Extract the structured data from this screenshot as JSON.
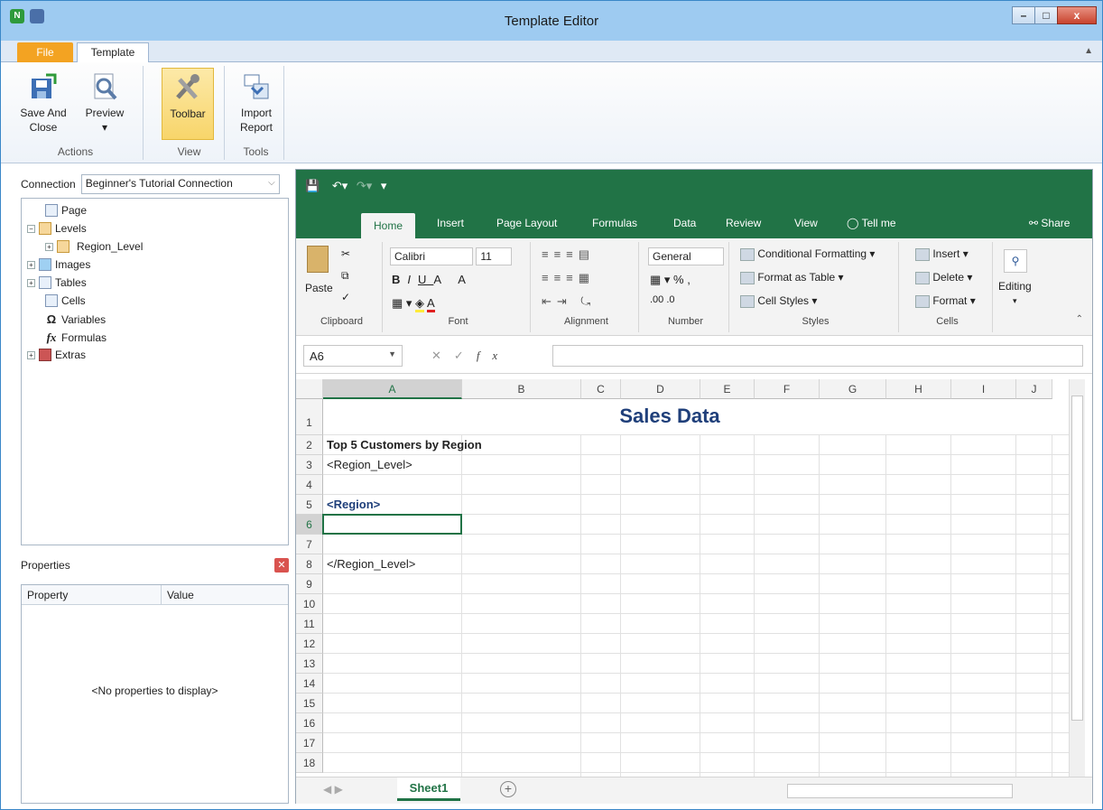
{
  "window": {
    "title": "Template Editor",
    "minimize": "–",
    "maximize": "□",
    "close": "x",
    "app_icon": "N"
  },
  "tabs": {
    "file": "File",
    "template": "Template",
    "collapse_icon": "chevron-up-icon"
  },
  "ribbon": {
    "groups": [
      {
        "label": "Actions",
        "buttons": [
          "Save And Close",
          "Preview"
        ]
      },
      {
        "label": "View",
        "buttons": [
          "Toolbar"
        ]
      },
      {
        "label": "Tools",
        "buttons": [
          "Import Report"
        ]
      }
    ],
    "save_line1": "Save And",
    "save_line2": "Close",
    "preview": "Preview",
    "preview_dd": "▾",
    "toolbar": "Toolbar",
    "import_line1": "Import",
    "import_line2": "Report",
    "actions_label": "Actions",
    "view_label": "View",
    "tools_label": "Tools"
  },
  "connection": {
    "label": "Connection",
    "value": "Beginner's Tutorial Connection"
  },
  "tree": {
    "page": "Page",
    "levels": "Levels",
    "region_level": "Region_Level",
    "images": "Images",
    "tables": "Tables",
    "cells": "Cells",
    "variables": "Variables",
    "formulas": "Formulas",
    "extras": "Extras"
  },
  "properties": {
    "title": "Properties",
    "col_property": "Property",
    "col_value": "Value",
    "empty": "<No properties to display>"
  },
  "excel": {
    "tabs": [
      "Home",
      "Insert",
      "Page Layout",
      "Formulas",
      "Data",
      "Review",
      "View",
      "Tell me"
    ],
    "share": "Share",
    "paste": "Paste",
    "clipboard": "Clipboard",
    "font_name": "Calibri",
    "font_size": "11",
    "font": "Font",
    "alignment": "Alignment",
    "number_format": "General",
    "number": "Number",
    "conditional_formatting": "Conditional Formatting",
    "format_as_table": "Format as Table",
    "cell_styles": "Cell Styles",
    "styles": "Styles",
    "insert": "Insert",
    "delete": "Delete",
    "format": "Format",
    "cells": "Cells",
    "editing": "Editing",
    "namebox": "A6",
    "columns": [
      "A",
      "B",
      "C",
      "D",
      "E",
      "F",
      "G",
      "H",
      "I",
      "J"
    ],
    "rows": [
      "1",
      "2",
      "3",
      "4",
      "5",
      "6",
      "7",
      "8",
      "9",
      "10",
      "11",
      "12",
      "13",
      "14",
      "15",
      "16",
      "17",
      "18"
    ],
    "cell_title": "Sales Data",
    "cell_a2": "Top 5 Customers by Region",
    "cell_a3": "<Region_Level>",
    "cell_a5": "<Region>",
    "cell_a8": "</Region_Level>",
    "sheet": "Sheet1",
    "add_sheet": "+"
  },
  "colors": {
    "excel_green": "#217346",
    "title_blue": "#1f3f7a",
    "file_orange": "#f3a322",
    "titlebar": "#9ecbf1"
  }
}
